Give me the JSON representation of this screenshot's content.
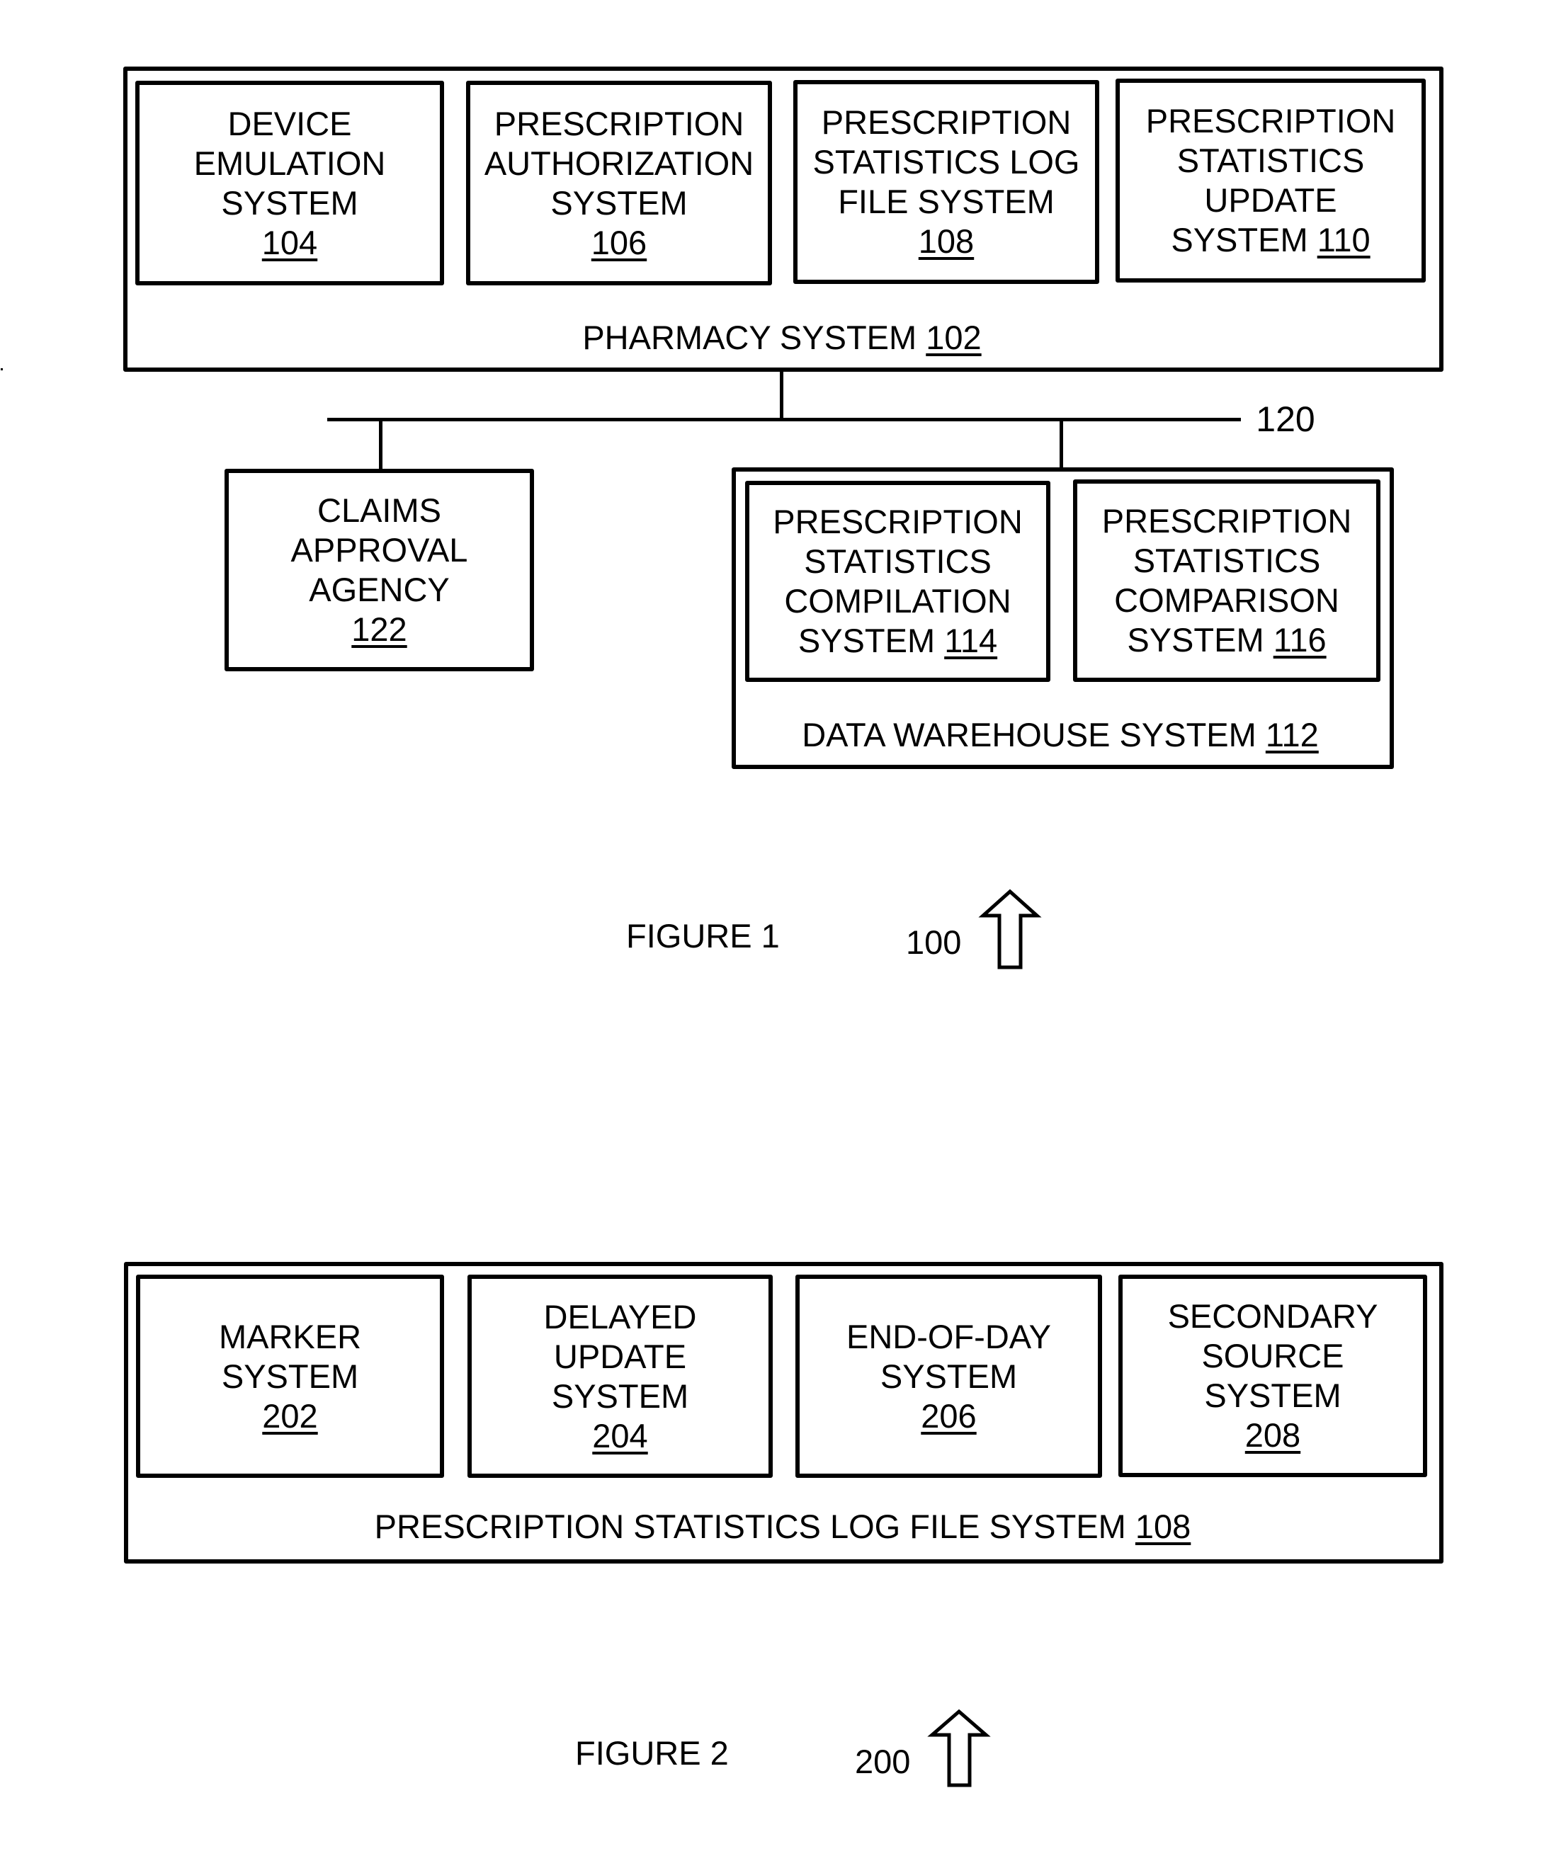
{
  "figure1": {
    "caption": "FIGURE 1",
    "ref": "100",
    "pharmacy": {
      "name": "PHARMACY SYSTEM",
      "ref": "102",
      "components": [
        {
          "lines": [
            "DEVICE",
            "EMULATION",
            "SYSTEM"
          ],
          "ref": "104"
        },
        {
          "lines": [
            "PRESCRIPTION",
            "AUTHORIZATION",
            "SYSTEM"
          ],
          "ref": "106"
        },
        {
          "lines": [
            "PRESCRIPTION",
            "STATISTICS LOG",
            "FILE SYSTEM"
          ],
          "ref": "108"
        },
        {
          "lines": [
            "PRESCRIPTION",
            "STATISTICS",
            "UPDATE"
          ],
          "last_line": "SYSTEM",
          "ref": "110"
        }
      ]
    },
    "network": {
      "ref": "120"
    },
    "claims": {
      "lines": [
        "CLAIMS",
        "APPROVAL",
        "AGENCY"
      ],
      "ref": "122"
    },
    "data_warehouse": {
      "name": "DATA WAREHOUSE SYSTEM",
      "ref": "112",
      "components": [
        {
          "lines": [
            "PRESCRIPTION",
            "STATISTICS",
            "COMPILATION"
          ],
          "last_line": "SYSTEM",
          "ref": "114"
        },
        {
          "lines": [
            "PRESCRIPTION",
            "STATISTICS",
            "COMPARISON"
          ],
          "last_line": "SYSTEM",
          "ref": "116"
        }
      ]
    }
  },
  "figure2": {
    "caption": "FIGURE 2",
    "ref": "200",
    "log_file_system": {
      "name": "PRESCRIPTION STATISTICS LOG FILE SYSTEM",
      "ref": "108",
      "components": [
        {
          "lines": [
            "MARKER",
            "SYSTEM"
          ],
          "ref": "202"
        },
        {
          "lines": [
            "DELAYED",
            "UPDATE",
            "SYSTEM"
          ],
          "ref": "204"
        },
        {
          "lines": [
            "END-OF-DAY",
            "SYSTEM"
          ],
          "ref": "206"
        },
        {
          "lines": [
            "SECONDARY",
            "SOURCE",
            "SYSTEM"
          ],
          "ref": "208"
        }
      ]
    }
  }
}
